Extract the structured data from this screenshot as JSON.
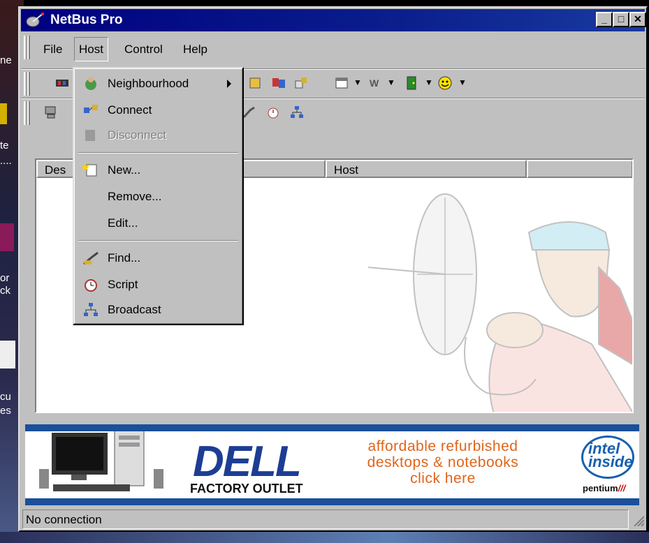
{
  "window": {
    "title": "NetBus Pro",
    "controls": {
      "minimize": "_",
      "maximize": "□",
      "close": "✕"
    }
  },
  "menubar": {
    "items": [
      {
        "label": "File",
        "underline": "F"
      },
      {
        "label": "Host",
        "underline": "o"
      },
      {
        "label": "Control",
        "underline": "C"
      },
      {
        "label": "Help",
        "underline": "H"
      }
    ],
    "active": "Host"
  },
  "host_menu": {
    "items": [
      {
        "label": "Neighbourhood",
        "icon": "globe-person-icon",
        "submenu": true,
        "enabled": true
      },
      {
        "label": "Connect",
        "icon": "connect-icon",
        "enabled": true
      },
      {
        "label": "Disconnect",
        "icon": "disconnect-icon",
        "enabled": false
      },
      {
        "label": "New...",
        "icon": "new-star-icon",
        "enabled": true
      },
      {
        "label": "Remove...",
        "icon": "",
        "enabled": true
      },
      {
        "label": "Edit...",
        "icon": "",
        "enabled": true
      },
      {
        "label": "Find...",
        "icon": "find-icon",
        "enabled": true
      },
      {
        "label": "Script",
        "icon": "clock-icon",
        "enabled": true
      },
      {
        "label": "Broadcast",
        "icon": "network-icon",
        "enabled": true
      }
    ]
  },
  "list": {
    "columns": [
      "Des",
      "Host",
      ""
    ]
  },
  "banner": {
    "brand": "DELL",
    "subtitle": "FACTORY OUTLET",
    "offer_line1": "affordable refurbished",
    "offer_line2": "desktops & notebooks",
    "offer_line3": "click here",
    "intel_line1": "intel",
    "intel_line2": "inside",
    "processor": "pentium",
    "processor_suffix": "///"
  },
  "status": {
    "text": "No connection"
  },
  "desktop_fragments": [
    "ne",
    "te",
    "....",
    "or",
    "ck",
    "cu",
    "es"
  ],
  "colors": {
    "titlebar": "#000080",
    "face": "#c0c0c0",
    "dell_blue": "#1d3d94",
    "offer_orange": "#e0651a"
  }
}
